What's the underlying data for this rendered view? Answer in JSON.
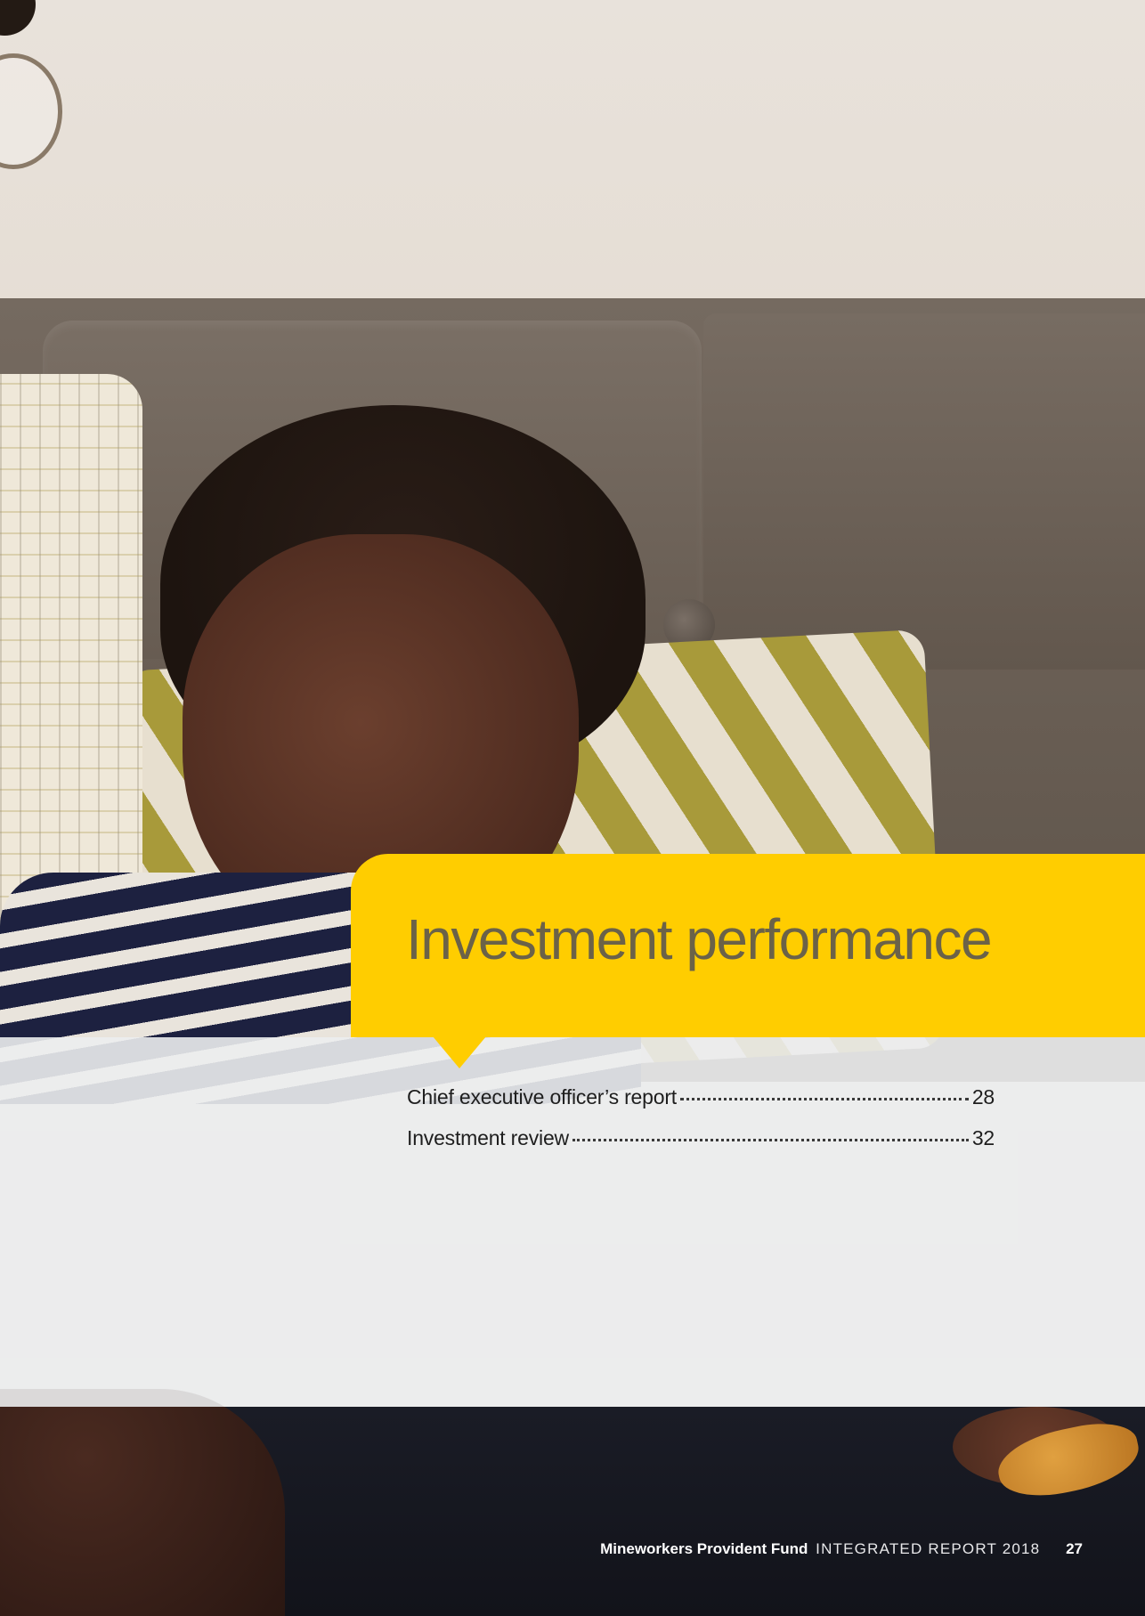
{
  "section": {
    "title": "Investment performance"
  },
  "toc": {
    "entries": [
      {
        "label": "Chief executive officer’s report",
        "page": "28"
      },
      {
        "label": "Investment review",
        "page": "32"
      }
    ]
  },
  "footer": {
    "fund_name": "Mineworkers Provident Fund",
    "report_name": "INTEGRATED REPORT 2018",
    "page_number": "27"
  },
  "colors": {
    "accent": "#ffcd00",
    "title_text": "#6b6248"
  }
}
